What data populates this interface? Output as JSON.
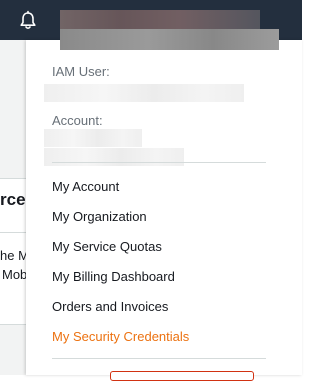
{
  "background": {
    "heading_fragment": "rces",
    "text_line1": "he M",
    "text_line2": "Mob"
  },
  "account_menu": {
    "iam_user_label": "IAM User:",
    "account_label": "Account:",
    "items": [
      {
        "label": "My Account"
      },
      {
        "label": "My Organization"
      },
      {
        "label": "My Service Quotas"
      },
      {
        "label": "My Billing Dashboard"
      },
      {
        "label": "Orders and Invoices"
      },
      {
        "label": "My Security Credentials",
        "active": true
      }
    ]
  },
  "colors": {
    "topbar": "#232f3e",
    "active_item": "#ec7211",
    "text": "#16191f",
    "label": "#687078"
  },
  "icons": [
    "bell-icon"
  ]
}
